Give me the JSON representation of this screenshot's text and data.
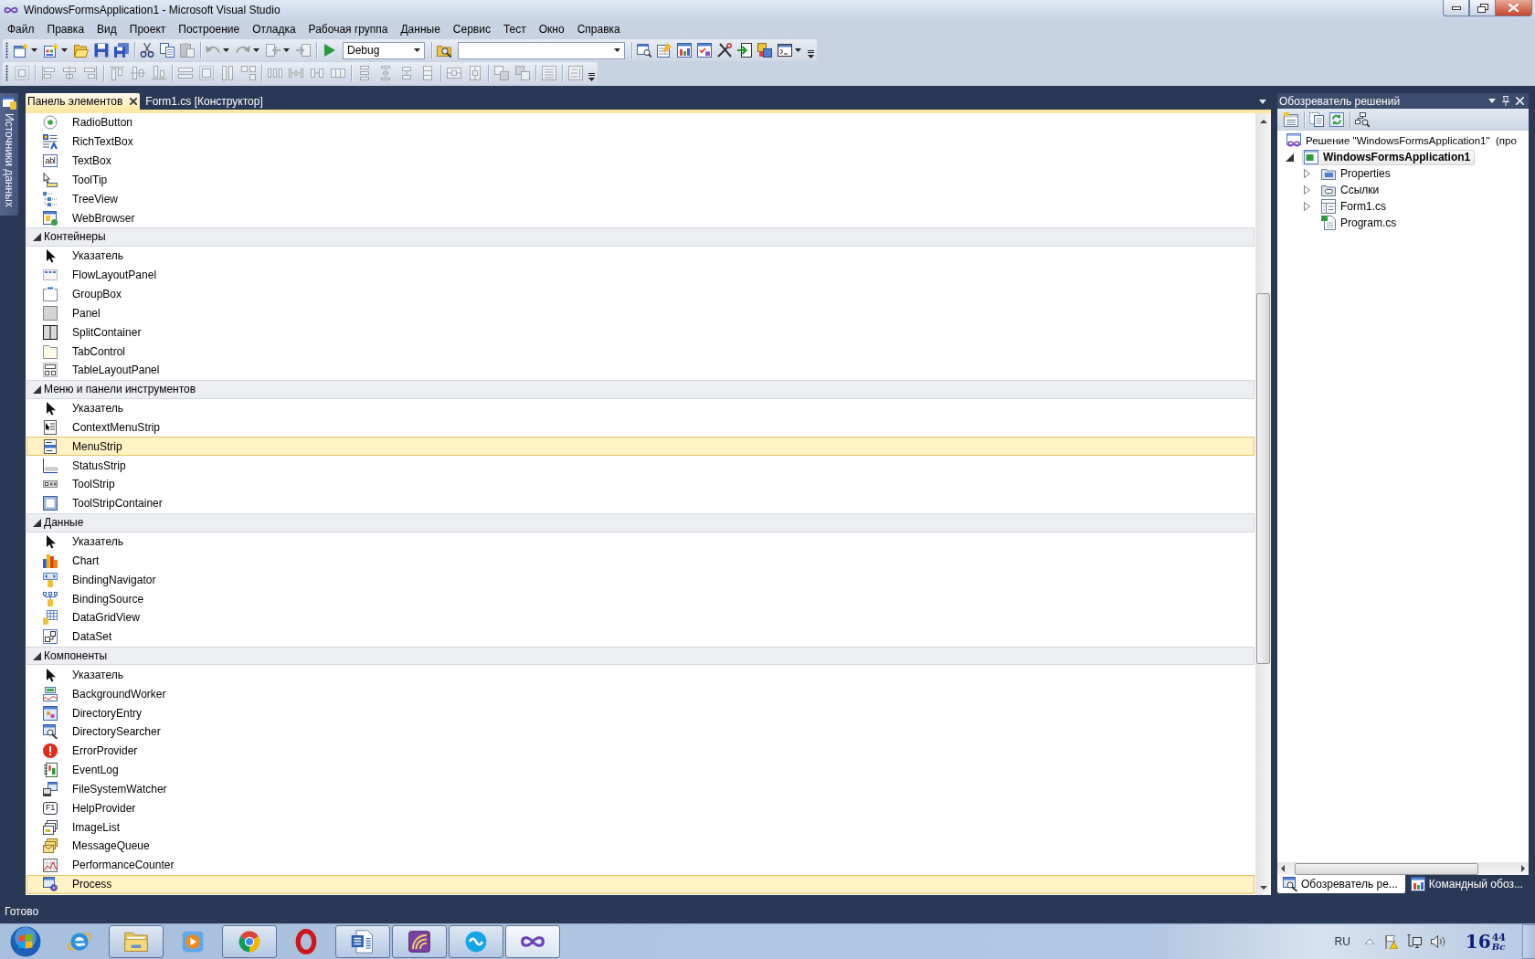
{
  "window": {
    "title": "WindowsFormsApplication1 - Microsoft Visual Studio"
  },
  "menu": [
    "Файл",
    "Правка",
    "Вид",
    "Проект",
    "Построение",
    "Отладка",
    "Рабочая группа",
    "Данные",
    "Сервис",
    "Тест",
    "Окно",
    "Справка"
  ],
  "toolbars": [
    {
      "items": [
        {
          "kind": "new-project",
          "split": true,
          "disabled": false
        },
        {
          "kind": "add-item",
          "split": true,
          "disabled": false
        },
        {
          "kind": "open",
          "disabled": false
        },
        {
          "kind": "save",
          "disabled": false
        },
        {
          "kind": "save-all",
          "disabled": false
        },
        {
          "kind": "separator"
        },
        {
          "kind": "cut",
          "disabled": false
        },
        {
          "kind": "copy",
          "disabled": false
        },
        {
          "kind": "paste",
          "disabled": true
        },
        {
          "kind": "separator"
        },
        {
          "kind": "undo",
          "split": true,
          "disabled": true
        },
        {
          "kind": "redo",
          "split": true,
          "disabled": true
        },
        {
          "kind": "back",
          "split": true,
          "disabled": true
        },
        {
          "kind": "forward",
          "disabled": true
        },
        {
          "kind": "separator"
        },
        {
          "kind": "start",
          "disabled": false
        },
        {
          "kind": "config-combo",
          "value": "Debug"
        },
        {
          "kind": "separator"
        },
        {
          "kind": "find-files",
          "disabled": false
        },
        {
          "kind": "find-combo"
        },
        {
          "kind": "separator"
        },
        {
          "kind": "window-search",
          "disabled": false
        },
        {
          "kind": "properties",
          "disabled": false
        },
        {
          "kind": "object-browser",
          "disabled": false
        },
        {
          "kind": "toolbox",
          "disabled": false
        },
        {
          "kind": "tools",
          "disabled": false
        },
        {
          "kind": "arrow-in",
          "disabled": false
        },
        {
          "kind": "layers",
          "disabled": false
        },
        {
          "kind": "console",
          "split": true,
          "disabled": false
        }
      ]
    },
    {
      "items": [
        {
          "kind": "grid-align",
          "disabled": true
        },
        {
          "kind": "separator"
        },
        {
          "kind": "align-left",
          "disabled": true
        },
        {
          "kind": "align-center",
          "disabled": true
        },
        {
          "kind": "align-right",
          "disabled": true
        },
        {
          "kind": "separator"
        },
        {
          "kind": "align-top",
          "disabled": true
        },
        {
          "kind": "align-middle",
          "disabled": true
        },
        {
          "kind": "align-bottom",
          "disabled": true
        },
        {
          "kind": "separator"
        },
        {
          "kind": "same-width",
          "disabled": true
        },
        {
          "kind": "size-grid",
          "disabled": true
        },
        {
          "kind": "same-height",
          "disabled": true
        },
        {
          "kind": "same-size",
          "disabled": true
        },
        {
          "kind": "separator"
        },
        {
          "kind": "hspace-equal",
          "disabled": true
        },
        {
          "kind": "hspace-inc",
          "disabled": true
        },
        {
          "kind": "hspace-dec",
          "disabled": true
        },
        {
          "kind": "hspace-none",
          "disabled": true
        },
        {
          "kind": "separator"
        },
        {
          "kind": "vspace-equal",
          "disabled": true
        },
        {
          "kind": "vspace-inc",
          "disabled": true
        },
        {
          "kind": "vspace-dec",
          "disabled": true
        },
        {
          "kind": "vspace-none",
          "disabled": true
        },
        {
          "kind": "separator"
        },
        {
          "kind": "center-h",
          "disabled": true
        },
        {
          "kind": "center-v",
          "disabled": true
        },
        {
          "kind": "separator"
        },
        {
          "kind": "front",
          "disabled": true
        },
        {
          "kind": "back-order",
          "disabled": true
        },
        {
          "kind": "separator"
        },
        {
          "kind": "tab-order",
          "disabled": true
        },
        {
          "kind": "separator"
        },
        {
          "kind": "list-edit",
          "disabled": true
        }
      ]
    }
  ],
  "side_tab": "Источники данных",
  "document_tabs": [
    {
      "label": "Панель элементов",
      "selected": true
    },
    {
      "label": "Form1.cs [Конструктор]",
      "selected": false
    }
  ],
  "toolbox": {
    "items": [
      {
        "label": "RadioButton",
        "kind": "radio",
        "selected": false
      },
      {
        "label": "RichTextBox",
        "kind": "richtext",
        "selected": false
      },
      {
        "label": "TextBox",
        "kind": "textbox",
        "glyph": "abl",
        "selected": false
      },
      {
        "label": "ToolTip",
        "kind": "tooltip",
        "selected": false
      },
      {
        "label": "TreeView",
        "kind": "tree",
        "selected": false
      },
      {
        "label": "WebBrowser",
        "kind": "browser",
        "selected": false
      }
    ],
    "groups": [
      {
        "header": "Контейнеры",
        "expanded": true,
        "items": [
          {
            "label": "Указатель",
            "kind": "pointer",
            "selected": false
          },
          {
            "label": "FlowLayoutPanel",
            "kind": "flow",
            "selected": false
          },
          {
            "label": "GroupBox",
            "kind": "groupbox",
            "selected": false
          },
          {
            "label": "Panel",
            "kind": "panel",
            "selected": false
          },
          {
            "label": "SplitContainer",
            "kind": "split",
            "selected": false
          },
          {
            "label": "TabControl",
            "kind": "tabs",
            "selected": false
          },
          {
            "label": "TableLayoutPanel",
            "kind": "table",
            "selected": false
          }
        ]
      },
      {
        "header": "Меню и панели инструментов",
        "expanded": true,
        "items": [
          {
            "label": "Указатель",
            "kind": "pointer",
            "selected": false
          },
          {
            "label": "ContextMenuStrip",
            "kind": "contextmenu",
            "selected": false
          },
          {
            "label": "MenuStrip",
            "kind": "menustrip",
            "selected": true
          },
          {
            "label": "StatusStrip",
            "kind": "statusstrip",
            "selected": false
          },
          {
            "label": "ToolStrip",
            "kind": "toolstrip",
            "selected": false
          },
          {
            "label": "ToolStripContainer",
            "kind": "container",
            "selected": false
          }
        ]
      },
      {
        "header": "Данные",
        "expanded": true,
        "items": [
          {
            "label": "Указатель",
            "kind": "pointer",
            "selected": false
          },
          {
            "label": "Chart",
            "kind": "chart",
            "selected": false
          },
          {
            "label": "BindingNavigator",
            "kind": "navigator",
            "selected": false
          },
          {
            "label": "BindingSource",
            "kind": "bindingsource",
            "selected": false
          },
          {
            "label": "DataGridView",
            "kind": "grid",
            "selected": false
          },
          {
            "label": "DataSet",
            "kind": "dataset",
            "selected": false
          }
        ]
      },
      {
        "header": "Компоненты",
        "expanded": true,
        "items": [
          {
            "label": "Указатель",
            "kind": "pointer",
            "selected": false
          },
          {
            "label": "BackgroundWorker",
            "kind": "worker",
            "selected": false
          },
          {
            "label": "DirectoryEntry",
            "kind": "direntry",
            "selected": false
          },
          {
            "label": "DirectorySearcher",
            "kind": "dirsearch",
            "selected": false
          },
          {
            "label": "ErrorProvider",
            "kind": "error",
            "selected": false
          },
          {
            "label": "EventLog",
            "kind": "eventlog",
            "selected": false
          },
          {
            "label": "FileSystemWatcher",
            "kind": "watcher",
            "selected": false
          },
          {
            "label": "HelpProvider",
            "kind": "key",
            "glyph": "F1",
            "selected": false
          },
          {
            "label": "ImageList",
            "kind": "imagelist",
            "selected": false
          },
          {
            "label": "MessageQueue",
            "kind": "queue",
            "selected": false
          },
          {
            "label": "PerformanceCounter",
            "kind": "perf",
            "selected": false
          },
          {
            "label": "Process",
            "kind": "process",
            "selected": true
          }
        ]
      }
    ]
  },
  "solution_explorer": {
    "title": "Обозреватель решений",
    "solution": "Решение \"WindowsFormsApplication1\"  (про",
    "tree": [
      {
        "label": "WindowsFormsApplication1",
        "kind": "project",
        "selected": true,
        "startup": true,
        "expandable": true,
        "expanded": true,
        "children": [
          {
            "label": "Properties",
            "kind": "properties",
            "selected": false,
            "startup": false,
            "expandable": true,
            "expanded": false
          },
          {
            "label": "Ссылки",
            "kind": "references",
            "selected": false,
            "startup": false,
            "expandable": true,
            "expanded": false
          },
          {
            "label": "Form1.cs",
            "kind": "form",
            "selected": false,
            "startup": false,
            "expandable": true,
            "expanded": false
          },
          {
            "label": "Program.cs",
            "kind": "code",
            "selected": false,
            "startup": false,
            "expandable": false
          }
        ]
      }
    ],
    "tabs": [
      {
        "label": "Обозреватель ре...",
        "kind": "explorer",
        "selected": true
      },
      {
        "label": "Командный обоз...",
        "kind": "team",
        "selected": false
      }
    ]
  },
  "status_bar": {
    "text": "Готово"
  },
  "taskbar": {
    "apps": [
      {
        "kind": "globe",
        "running": false,
        "selected": false
      },
      {
        "kind": "folder",
        "running": true,
        "selected": false
      },
      {
        "kind": "player",
        "running": false,
        "selected": false
      },
      {
        "kind": "wheel",
        "running": true,
        "selected": false
      },
      {
        "kind": "ring",
        "running": false,
        "selected": false
      },
      {
        "kind": "document",
        "running": true,
        "selected": false
      },
      {
        "kind": "swirl",
        "running": true,
        "selected": false
      },
      {
        "kind": "chat",
        "running": true,
        "selected": false
      },
      {
        "kind": "infinity",
        "running": true,
        "selected": true
      }
    ],
    "language": "RU",
    "clock": {
      "hours": "16",
      "minutes": "44",
      "day": "Вс"
    }
  }
}
